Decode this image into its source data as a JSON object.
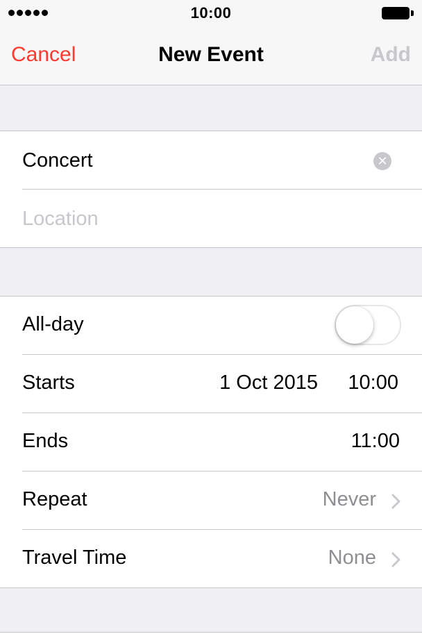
{
  "status": {
    "time": "10:00"
  },
  "nav": {
    "cancel": "Cancel",
    "title": "New Event",
    "add": "Add"
  },
  "details": {
    "title_value": "Concert",
    "location_placeholder": "Location"
  },
  "schedule": {
    "allday_label": "All-day",
    "allday_on": false,
    "starts_label": "Starts",
    "starts_date": "1 Oct 2015",
    "starts_time": "10:00",
    "ends_label": "Ends",
    "ends_time": "11:00",
    "repeat_label": "Repeat",
    "repeat_value": "Never",
    "travel_label": "Travel Time",
    "travel_value": "None"
  },
  "colors": {
    "accent": "#ff3b30",
    "disabled": "#c7c7cc",
    "secondary_text": "#8e8e93",
    "background": "#efeff4"
  }
}
